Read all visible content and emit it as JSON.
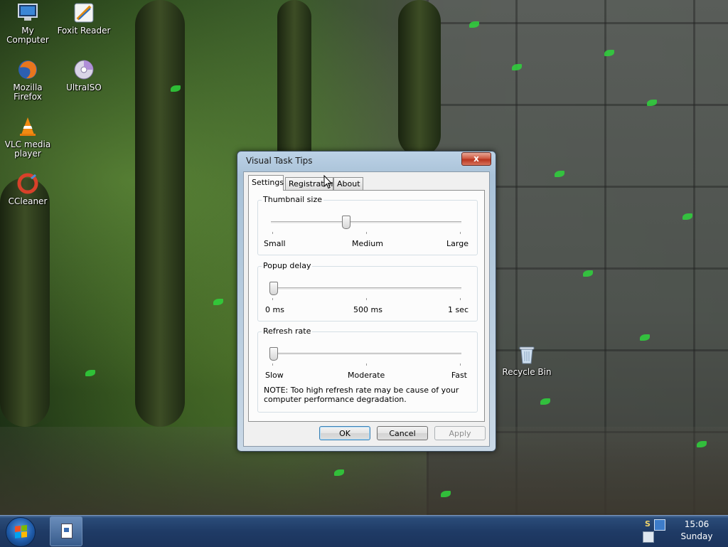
{
  "desktop": {
    "icons": [
      {
        "label": "My Computer",
        "icon": "computer-icon"
      },
      {
        "label": "Foxit Reader",
        "icon": "pdf-reader-icon"
      },
      {
        "label": "Mozilla Firefox",
        "icon": "firefox-icon"
      },
      {
        "label": "UltraISO",
        "icon": "disc-icon"
      },
      {
        "label": "VLC media player",
        "icon": "vlc-cone-icon"
      },
      {
        "label": "CCleaner",
        "icon": "ccleaner-icon"
      },
      {
        "label": "Recycle Bin",
        "icon": "recycle-bin-icon"
      }
    ]
  },
  "dialog": {
    "title": "Visual Task Tips",
    "close_label": "x",
    "tabs": [
      {
        "label": "Settings",
        "active": true
      },
      {
        "label": "Registration",
        "active": false
      },
      {
        "label": "About",
        "active": false
      }
    ],
    "groups": {
      "thumbnail": {
        "title": "Thumbnail size",
        "min_label": "Small",
        "mid_label": "Medium",
        "max_label": "Large",
        "value_fraction": 0.38
      },
      "popup": {
        "title": "Popup delay",
        "min_label": "0 ms",
        "mid_label": "500 ms",
        "max_label": "1 sec",
        "value_fraction": 0.0
      },
      "refresh": {
        "title": "Refresh rate",
        "min_label": "Slow",
        "mid_label": "Moderate",
        "max_label": "Fast",
        "value_fraction": 0.0,
        "note": "NOTE: Too high refresh rate may be cause of your computer performance degradation."
      }
    },
    "buttons": {
      "ok": "OK",
      "cancel": "Cancel",
      "apply": "Apply"
    }
  },
  "taskbar": {
    "clock_time": "15:06",
    "clock_day": "Sunday",
    "tray_icons": [
      "s-icon",
      "network-icon",
      "display-icon"
    ]
  },
  "colors": {
    "taskbar": "#1f3b66",
    "close_button": "#cf5a43",
    "dialog_frame": "#a9c2d8"
  }
}
